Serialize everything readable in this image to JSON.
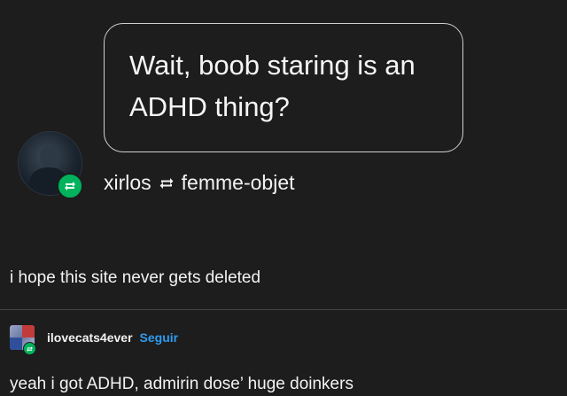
{
  "ask": {
    "text": "Wait, boob staring is an ADHD thing?"
  },
  "reblog": {
    "from_user": "xirlos",
    "to_user": "femme-objet"
  },
  "post": {
    "text": "i hope this site never gets deleted"
  },
  "reply": {
    "username": "ilovecats4ever",
    "follow_label": "Seguir",
    "text": "yeah i got ADHD, admirin dose’ huge doinkers"
  },
  "colors": {
    "background": "#1d1d1d",
    "text": "#f2f2f2",
    "reblog_green": "#00b35c",
    "follow_blue": "#2f9bf0",
    "bubble_border": "#cfcfcf"
  },
  "icons": [
    "avatar",
    "reblog-icon",
    "reblog-arrows-icon",
    "small-avatar",
    "small-reblog-icon"
  ]
}
